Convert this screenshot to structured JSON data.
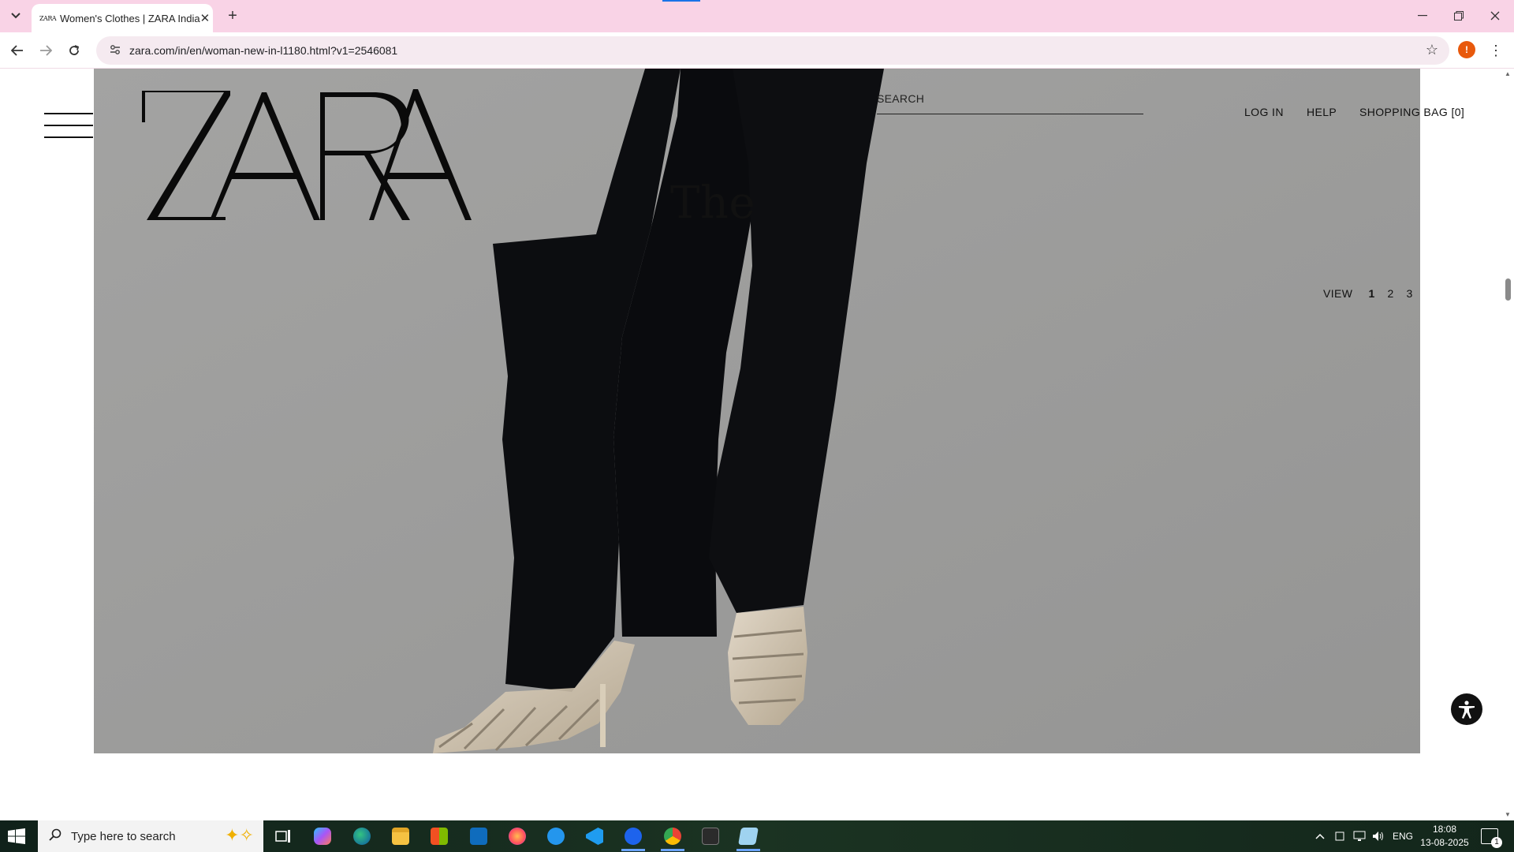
{
  "browser": {
    "tab_title": "Women's Clothes | ZARA India",
    "favicon_text": "ZARA",
    "url": "zara.com/in/en/woman-new-in-l1180.html?v1=2546081",
    "profile_initial": "!",
    "icons": {
      "tab_list": "chevron-down-icon",
      "tab_close": "close-icon",
      "new_tab": "plus-icon",
      "minimize": "minimize-icon",
      "restore": "restore-icon",
      "close": "close-icon",
      "back": "back-arrow-icon",
      "forward": "forward-arrow-icon",
      "reload": "reload-icon",
      "site_info": "site-settings-icon",
      "bookmark": "star-icon",
      "menu": "kebab-menu-icon"
    }
  },
  "page": {
    "brand": "ZARA",
    "search_label": "SEARCH",
    "nav": {
      "login": "LOG IN",
      "help": "HELP",
      "shopping_bag": "SHOPPING BAG [0]"
    },
    "headline": "The",
    "view_switch": {
      "label": "VIEW",
      "options": [
        "1",
        "2",
        "3"
      ],
      "active": "1"
    },
    "colors": {
      "hero_background": "#9c9c9b",
      "text": "#111111"
    }
  },
  "taskbar": {
    "search_placeholder": "Type here to search",
    "language": "ENG",
    "time": "18:08",
    "date": "13-08-2025",
    "notification_count": "1",
    "apps": [
      "task-view",
      "copilot",
      "edge",
      "file-explorer",
      "microsoft-store",
      "outlook",
      "firefox",
      "docker",
      "vscode",
      "docker-desktop",
      "chrome",
      "terminal",
      "notepad"
    ]
  }
}
